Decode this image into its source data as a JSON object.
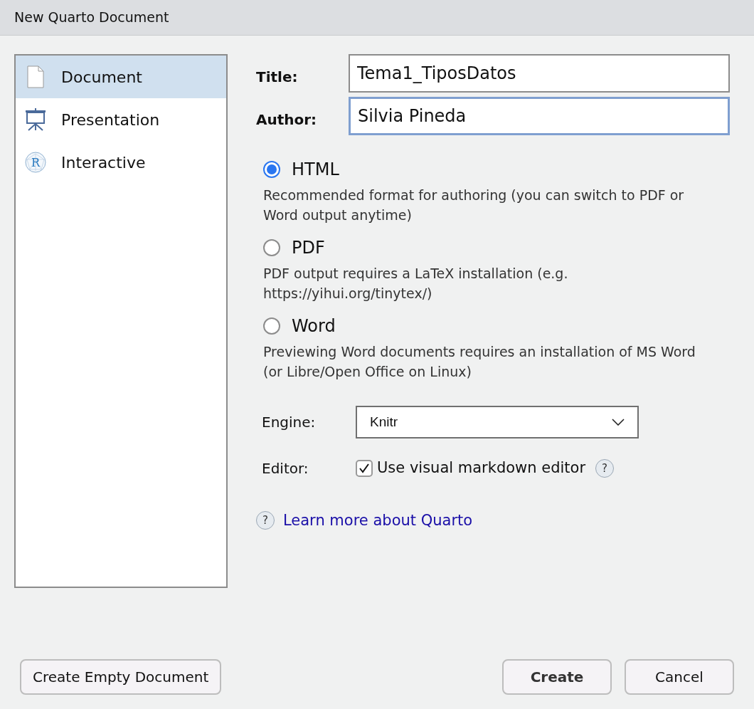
{
  "window": {
    "title": "New Quarto Document"
  },
  "sidebar": {
    "items": [
      {
        "kind": "document",
        "label": "Document",
        "selected": true
      },
      {
        "kind": "presentation",
        "label": "Presentation",
        "selected": false
      },
      {
        "kind": "interactive",
        "label": "Interactive",
        "selected": false,
        "icon_letter": "R"
      }
    ]
  },
  "fields": [
    {
      "label": "Title:",
      "value": "Tema1_TiposDatos",
      "focused": false
    },
    {
      "label": "Author:",
      "value": "Silvia Pineda",
      "focused": true
    }
  ],
  "formats": [
    {
      "label": "HTML",
      "description": "Recommended format for authoring (you can switch to PDF or Word output anytime)",
      "selected": true
    },
    {
      "label": "PDF",
      "description": "PDF output requires a LaTeX installation (e.g. https://yihui.org/tinytex/)",
      "selected": false
    },
    {
      "label": "Word",
      "description": "Previewing Word documents requires an installation of MS Word (or Libre/Open Office on Linux)",
      "selected": false
    }
  ],
  "engine": {
    "label": "Engine:",
    "value": "Knitr"
  },
  "editor": {
    "label": "Editor:",
    "option": "Use visual markdown editor",
    "checked": true,
    "help_icon": "?"
  },
  "help_link": {
    "icon": "?",
    "label": "Learn more about Quarto"
  },
  "buttons": {
    "left": "Create Empty Document",
    "primary": "Create",
    "cancel": "Cancel"
  }
}
